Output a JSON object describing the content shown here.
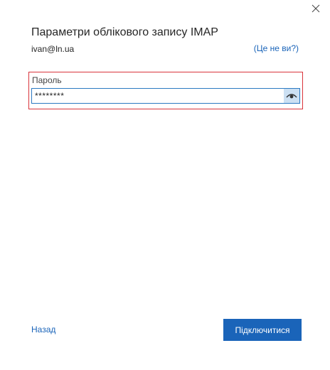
{
  "header": {
    "title": "Параметри облікового запису IMAP",
    "email": "ivan@ln.ua",
    "not_you_link": "(Це не ви?)"
  },
  "password_field": {
    "label": "Пароль",
    "value": "********",
    "reveal_icon": "eye-icon"
  },
  "footer": {
    "back_label": "Назад",
    "connect_label": "Підключитися"
  },
  "window": {
    "close_icon": "close-icon"
  },
  "colors": {
    "accent": "#1a64b9",
    "highlight_border": "#d9343b",
    "input_border": "#2b79c2",
    "reveal_bg": "#cce0f3"
  }
}
